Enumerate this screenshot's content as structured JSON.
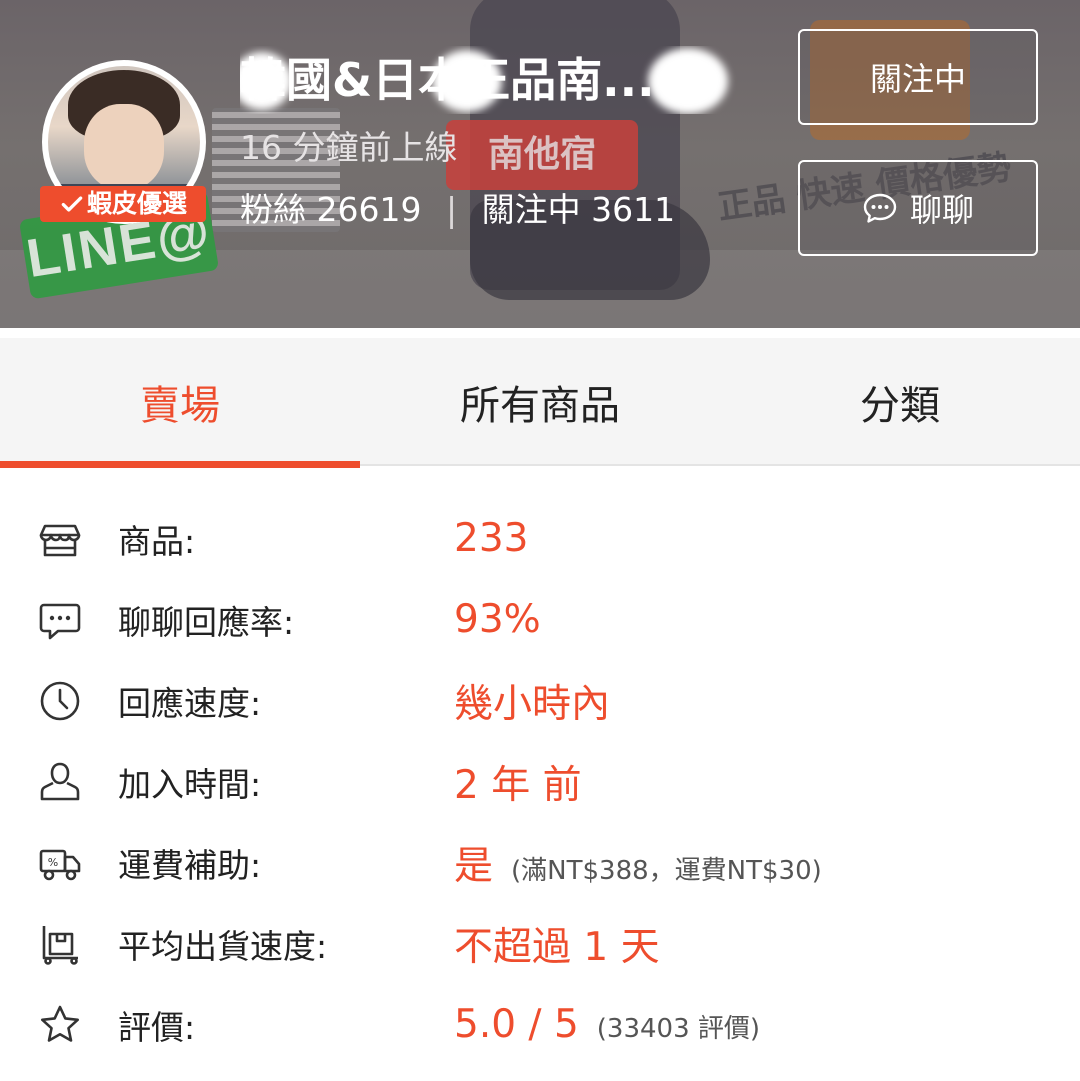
{
  "header": {
    "shop_name": "韓國&日本正品南...",
    "online_status": "16 分鐘前上線",
    "badge": "蝦皮優選",
    "followers_label": "粉絲",
    "followers_count": "26619",
    "separator": "|",
    "following_label": "關注中",
    "following_count": "3611",
    "follow_button": "關注中",
    "chat_button": "聊聊",
    "bg_texts": {
      "line": "LINE@",
      "sign": "南他宿",
      "slogan": "正品 快速 價格優勢"
    }
  },
  "tabs": [
    {
      "label": "賣場",
      "active": true
    },
    {
      "label": "所有商品",
      "active": false
    },
    {
      "label": "分類",
      "active": false
    }
  ],
  "info": [
    {
      "icon": "store-icon",
      "label": "商品:",
      "value": "233",
      "note": ""
    },
    {
      "icon": "chat-bubble-icon",
      "label": "聊聊回應率:",
      "value": "93%",
      "note": ""
    },
    {
      "icon": "clock-icon",
      "label": "回應速度:",
      "value": "幾小時內",
      "note": ""
    },
    {
      "icon": "user-icon",
      "label": "加入時間:",
      "value": "2 年 前",
      "note": ""
    },
    {
      "icon": "shipping-truck-icon",
      "label": "運費補助:",
      "value": "是",
      "note": "(滿NT$388，運費NT$30)"
    },
    {
      "icon": "package-icon",
      "label": "平均出貨速度:",
      "value": "不超過 1 天",
      "note": ""
    },
    {
      "icon": "star-icon",
      "label": "評價:",
      "value": "5.0 / 5",
      "note": "(33403 評價)"
    }
  ],
  "colors": {
    "accent": "#ee4d2d",
    "header_overlay": "#6e6a6a",
    "tab_bar": "#f5f5f5"
  }
}
